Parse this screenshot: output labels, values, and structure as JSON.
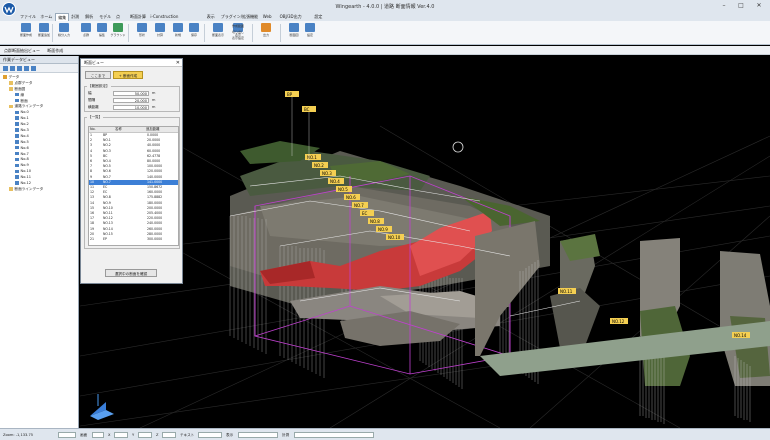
{
  "window": {
    "title": "Wingearth - 4.0.0 | 道路 断面情報 Ver.4.0",
    "controls": {
      "minimize": "–",
      "maximize": "□",
      "close": "✕"
    }
  },
  "ribbon_tabs": [
    "ファイル",
    "ホーム",
    "編集",
    "計測",
    "解析",
    "モデル",
    "点",
    "断面計算",
    "i-Construction",
    "表示",
    "プラグイン/拡張機能",
    "Web",
    "OBJ/3D出力",
    "設定"
  ],
  "active_tab_index": 2,
  "ribbon_buttons": [
    {
      "label": "断面作成",
      "color": "blue"
    },
    {
      "label": "断面追加",
      "color": "blue"
    },
    {
      "label": "線分入力",
      "color": "blue"
    },
    {
      "label": "点群",
      "color": "blue"
    },
    {
      "label": "編集",
      "color": "blue"
    },
    {
      "label": "グラウンド",
      "color": "green"
    },
    {
      "label": "形状",
      "color": "blue"
    },
    {
      "label": "計算",
      "color": "blue"
    },
    {
      "label": "新規",
      "color": "blue"
    },
    {
      "label": "保存",
      "color": "blue"
    },
    {
      "label": "断面表示",
      "color": "blue"
    },
    {
      "label": "表示",
      "color": "blue"
    },
    {
      "label": "出力",
      "color": "orange"
    },
    {
      "label": "断面図",
      "color": "blue"
    },
    {
      "label": "設定",
      "color": "blue"
    }
  ],
  "ribbon_small": [
    "作成範囲",
    "切り出し",
    "表示設定"
  ],
  "breadcrumb": [
    "点群断面抽出ビュー",
    "断面作成"
  ],
  "left_panel": {
    "title": "作業データビュー",
    "tree": [
      {
        "label": "データ",
        "level": 0
      },
      {
        "label": "点群データ",
        "level": 1
      },
      {
        "label": "断面図",
        "level": 1
      },
      {
        "label": "線",
        "level": 2
      },
      {
        "label": "断面",
        "level": 2
      },
      {
        "label": "道路ラインデータ",
        "level": 1
      },
      {
        "label": "No.0",
        "level": 2
      },
      {
        "label": "No.1",
        "level": 2
      },
      {
        "label": "No.2",
        "level": 2
      },
      {
        "label": "No.3",
        "level": 2
      },
      {
        "label": "No.4",
        "level": 2
      },
      {
        "label": "No.5",
        "level": 2
      },
      {
        "label": "No.6",
        "level": 2
      },
      {
        "label": "No.7",
        "level": 2
      },
      {
        "label": "No.8",
        "level": 2
      },
      {
        "label": "No.9",
        "level": 2
      },
      {
        "label": "No.10",
        "level": 2
      },
      {
        "label": "No.11",
        "level": 2
      },
      {
        "label": "No.12",
        "level": 2
      },
      {
        "label": "断面ラインデータ",
        "level": 1
      }
    ]
  },
  "dialog": {
    "title": "断面ビュー",
    "buttons": [
      "ここまで",
      "+ 断面作成"
    ],
    "params_label": "【範囲設定】",
    "params": [
      {
        "label": "幅",
        "value": "50.000",
        "unit": "m"
      },
      {
        "label": "間隔",
        "value": "20.000",
        "unit": "m"
      },
      {
        "label": "横距離",
        "value": "10.000",
        "unit": "m"
      }
    ],
    "list_label": "【一覧】",
    "columns": [
      "No.",
      "名称",
      "追加距離"
    ],
    "rows": [
      {
        "no": "1",
        "name": "BP",
        "dist": "0.0000"
      },
      {
        "no": "2",
        "name": "NO.1",
        "dist": "20.0000"
      },
      {
        "no": "3",
        "name": "NO.2",
        "dist": "40.0000"
      },
      {
        "no": "4",
        "name": "NO.3",
        "dist": "60.0000"
      },
      {
        "no": "5",
        "name": "BC",
        "dist": "62.4778"
      },
      {
        "no": "6",
        "name": "NO.4",
        "dist": "80.0000"
      },
      {
        "no": "7",
        "name": "NO.5",
        "dist": "100.0000"
      },
      {
        "no": "8",
        "name": "NO.6",
        "dist": "120.0000"
      },
      {
        "no": "9",
        "name": "NO.7",
        "dist": "140.0000"
      },
      {
        "no": "10",
        "name": "NO.7",
        "dist": "141.0000"
      },
      {
        "no": "11",
        "name": "EC",
        "dist": "150.8672"
      },
      {
        "no": "12",
        "name": "EC",
        "dist": "160.0000"
      },
      {
        "no": "13",
        "name": "NO.8",
        "dist": "175.8882"
      },
      {
        "no": "14",
        "name": "NO.9",
        "dist": "180.0000"
      },
      {
        "no": "15",
        "name": "NO.10",
        "dist": "200.0000"
      },
      {
        "no": "16",
        "name": "NO.11",
        "dist": "205.4000"
      },
      {
        "no": "17",
        "name": "NO.12",
        "dist": "220.0000"
      },
      {
        "no": "18",
        "name": "NO.13",
        "dist": "240.0000"
      },
      {
        "no": "19",
        "name": "NO.14",
        "dist": "260.0000"
      },
      {
        "no": "20",
        "name": "NO.15",
        "dist": "280.0000"
      },
      {
        "no": "21",
        "name": "EP",
        "dist": "300.0000"
      }
    ],
    "selected_row": 9,
    "bottom_button": "選択中の断面を確認"
  },
  "viewport": {
    "labels": [
      "BP",
      "BC",
      "NO.1",
      "NO.2",
      "NO.3",
      "NO.4",
      "NO.5",
      "NO.6",
      "NO.7",
      "EC",
      "NO.8",
      "NO.9",
      "NO.10",
      "NO.11",
      "NO.12",
      "NO.14"
    ]
  },
  "statusbar": {
    "left": "Zoom: -1,133.75",
    "items": [
      "画面",
      "X",
      "Y",
      "Z",
      "テキスト",
      "表示",
      "計測"
    ]
  }
}
